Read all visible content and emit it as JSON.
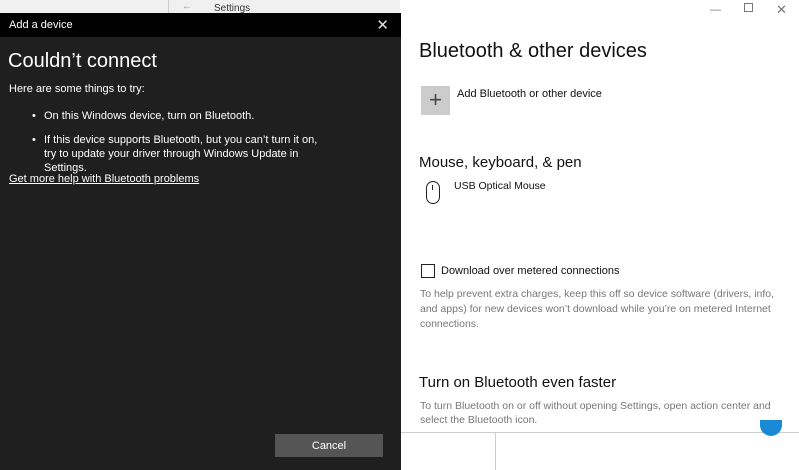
{
  "background_window": {
    "title": "Settings",
    "back_icon": "←"
  },
  "dialog": {
    "title": "Add a device",
    "heading": "Couldn’t connect",
    "intro": "Here are some things to try:",
    "tips": [
      "On this Windows device, turn on Bluetooth.",
      "If this device supports Bluetooth, but you can’t turn it on, try to update your driver through Windows Update in Settings."
    ],
    "help_link": "Get more help with Bluetooth problems",
    "cancel_label": "Cancel"
  },
  "settings": {
    "title": "Bluetooth & other devices",
    "add_label": "Add Bluetooth or other device",
    "section_mouse": "Mouse, keyboard, & pen",
    "device_name": "USB Optical Mouse",
    "metered_label": "Download over metered connections",
    "metered_checked": false,
    "metered_help": "To help prevent extra charges, keep this off so device software (drivers, info, and apps) for new devices won’t download while you’re on metered Internet connections.",
    "section_faster": "Turn on Bluetooth even faster",
    "faster_help": "To turn Bluetooth on or off without opening Settings, open action center and select the Bluetooth icon."
  },
  "accent_color": "#1a8ad4"
}
